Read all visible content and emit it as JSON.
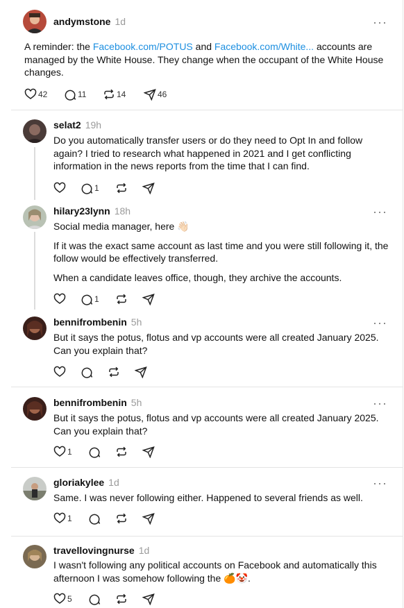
{
  "main_post": {
    "username": "andymstone",
    "time": "1d",
    "text_before": "A reminder: the ",
    "link1": "Facebook.com/POTUS",
    "text_mid": " and ",
    "link2": "Facebook.com/White...",
    "text_after": " accounts are managed by the White House. They change when the occupant of the White House changes.",
    "likes": "42",
    "replies": "11",
    "reposts": "14",
    "shares": "46"
  },
  "replies": [
    {
      "username": "selat2",
      "time": "19h",
      "paragraphs": [
        "Do you automatically transfer users or do they need to Opt In and follow again? I tried to research what happened in 2021 and I get conflicting information in the news reports from the time that I can find."
      ],
      "likes": "",
      "replies": "1"
    },
    {
      "username": "hilary23lynn",
      "time": "18h",
      "paragraphs": [
        "Social media manager, here 👋🏻",
        "If it was the exact same account as last time and you were still following it, the follow would be effectively transferred.",
        "When a candidate leaves office, though, they archive the accounts."
      ],
      "likes": "",
      "replies": "1"
    },
    {
      "username": "bennifrombenin",
      "time": "5h",
      "paragraphs": [
        "But it says the potus, flotus and vp accounts were all created January 2025. Can you explain that?"
      ],
      "likes": "",
      "replies": ""
    },
    {
      "username": "bennifrombenin",
      "time": "5h",
      "paragraphs": [
        "But it says the potus, flotus and vp accounts were all created January 2025. Can you explain that?"
      ],
      "likes": "1",
      "replies": ""
    },
    {
      "username": "gloriakylee",
      "time": "1d",
      "paragraphs": [
        "Same. I was never following either. Happened to several friends as well."
      ],
      "likes": "1",
      "replies": ""
    },
    {
      "username": "travellovingnurse",
      "time": "1d",
      "paragraphs": [
        "I wasn't following any political accounts on Facebook and automatically this afternoon I was somehow following the 🍊🤡."
      ],
      "likes": "5",
      "replies": ""
    }
  ],
  "more_label": "···",
  "icons": [
    "heart-icon",
    "comment-icon",
    "repost-icon",
    "share-icon",
    "more-icon"
  ]
}
